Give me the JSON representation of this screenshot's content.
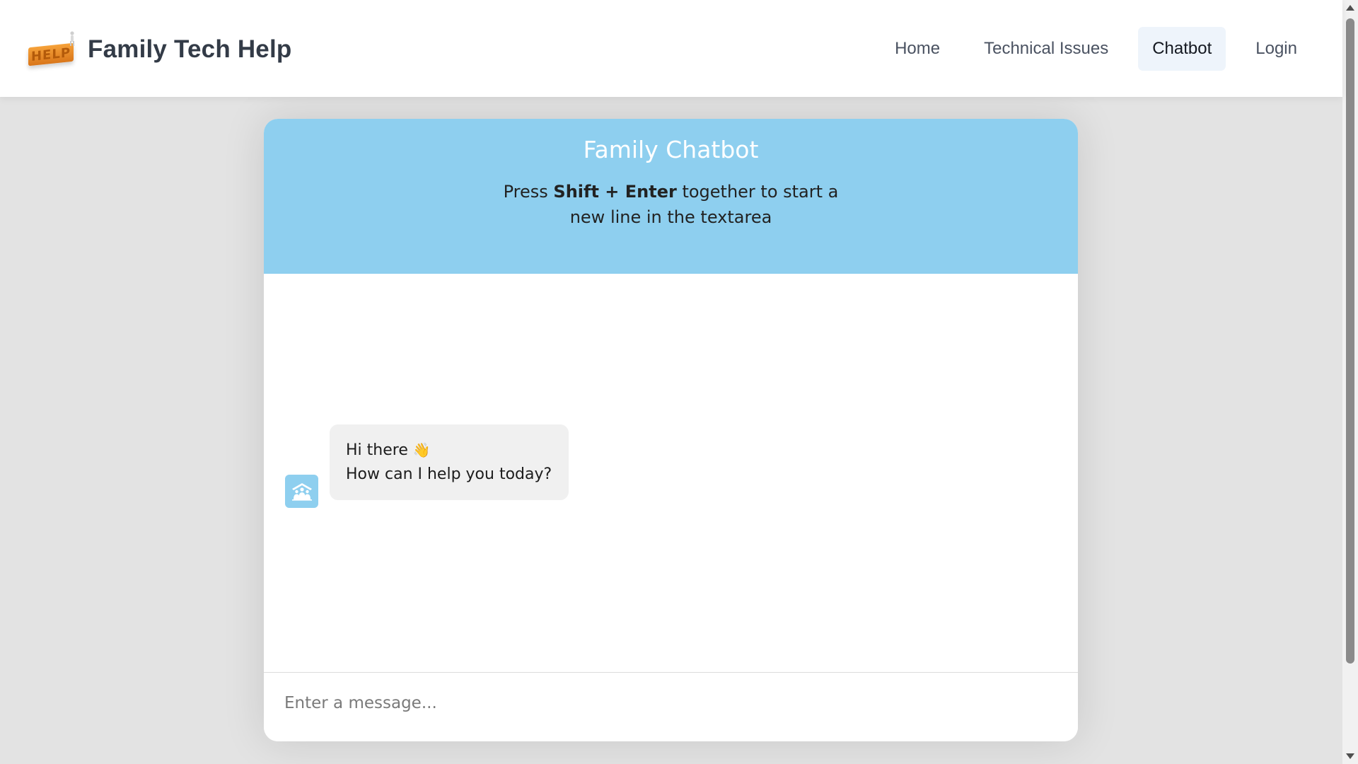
{
  "brand": {
    "title": "Family Tech Help",
    "logo_text": "HELP"
  },
  "nav": {
    "items": [
      {
        "label": "Home",
        "active": false
      },
      {
        "label": "Technical Issues",
        "active": false
      },
      {
        "label": "Chatbot",
        "active": true
      },
      {
        "label": "Login",
        "active": false
      }
    ]
  },
  "chat": {
    "title": "Family Chatbot",
    "hint_prefix": "Press ",
    "hint_keys": "Shift + Enter",
    "hint_suffix": " together to start a new line in the textarea",
    "messages": [
      {
        "from": "bot",
        "avatar_icon": "family-icon",
        "line1": "Hi there",
        "emoji": "👋",
        "line2": "How can I help you today?"
      }
    ],
    "input_placeholder": "Enter a message..."
  },
  "colors": {
    "header_bg": "#8ecfef",
    "page_bg": "#e3e3e3",
    "active_nav_bg": "#eef4fb",
    "bubble_bg": "#f0f0f0"
  }
}
